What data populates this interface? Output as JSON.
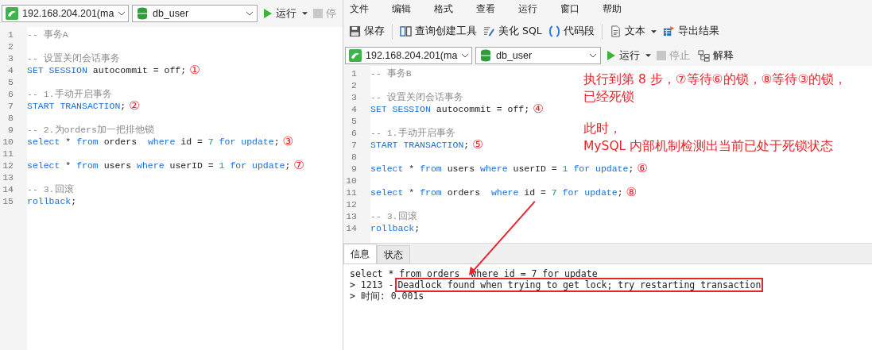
{
  "left_pane": {
    "connection": "192.168.204.201(ma",
    "database": "db_user",
    "run_button": "运行",
    "stop_button": "停",
    "code_lines": [
      {
        "number": "1",
        "tokens": [
          {
            "kind": "comment",
            "text": "-- 事务A"
          }
        ]
      },
      {
        "number": "2"
      },
      {
        "number": "3",
        "tokens": [
          {
            "kind": "comment",
            "text": "-- 设置关闭会话事务"
          }
        ]
      },
      {
        "number": "4",
        "tokens": [
          {
            "kind": "keyword",
            "text": "SET SESSION"
          },
          {
            "kind": "plain",
            "text": " autocommit = off;"
          }
        ],
        "marker": "①"
      },
      {
        "number": "5"
      },
      {
        "number": "6",
        "tokens": [
          {
            "kind": "comment",
            "text": "-- 1.手动开启事务"
          }
        ]
      },
      {
        "number": "7",
        "tokens": [
          {
            "kind": "keyword",
            "text": "START TRANSACTION"
          },
          {
            "kind": "plain",
            "text": ";"
          }
        ],
        "marker": "②"
      },
      {
        "number": "8"
      },
      {
        "number": "9",
        "tokens": [
          {
            "kind": "comment",
            "text": "-- 2.为orders加一把排他锁"
          }
        ]
      },
      {
        "number": "10",
        "tokens": [
          {
            "kind": "keyword",
            "text": "select"
          },
          {
            "kind": "plain",
            "text": " * "
          },
          {
            "kind": "keyword",
            "text": "from"
          },
          {
            "kind": "plain",
            "text": " orders  "
          },
          {
            "kind": "keyword",
            "text": "where"
          },
          {
            "kind": "plain",
            "text": " id = "
          },
          {
            "kind": "number",
            "text": "7"
          },
          {
            "kind": "keyword",
            "text": " for update"
          },
          {
            "kind": "plain",
            "text": ";"
          }
        ],
        "marker": "③"
      },
      {
        "number": "11"
      },
      {
        "number": "12",
        "tokens": [
          {
            "kind": "keyword",
            "text": "select"
          },
          {
            "kind": "plain",
            "text": " * "
          },
          {
            "kind": "keyword",
            "text": "from"
          },
          {
            "kind": "plain",
            "text": " users "
          },
          {
            "kind": "keyword",
            "text": "where"
          },
          {
            "kind": "plain",
            "text": " userID = "
          },
          {
            "kind": "number",
            "text": "1"
          },
          {
            "kind": "keyword",
            "text": " for update"
          },
          {
            "kind": "plain",
            "text": ";"
          }
        ],
        "marker": "⑦"
      },
      {
        "number": "13"
      },
      {
        "number": "14",
        "tokens": [
          {
            "kind": "comment",
            "text": "-- 3.回滚"
          }
        ]
      },
      {
        "number": "15",
        "tokens": [
          {
            "kind": "keyword",
            "text": "rollback"
          },
          {
            "kind": "plain",
            "text": ";"
          }
        ]
      }
    ]
  },
  "right_pane": {
    "menu": [
      "文件",
      "编辑",
      "格式",
      "查看",
      "运行",
      "窗口",
      "帮助"
    ],
    "toolbar": [
      {
        "kind": "save",
        "label": "保存"
      },
      {
        "kind": "builder",
        "label": "查询创建工具"
      },
      {
        "kind": "beautify",
        "label": "美化 SQL"
      },
      {
        "kind": "snippet",
        "label": "代码段"
      },
      {
        "kind": "text",
        "label": "文本"
      },
      {
        "kind": "export",
        "label": "导出结果"
      }
    ],
    "connection": "192.168.204.201(ma",
    "database": "db_user",
    "run_button": "运行",
    "stop_button": "停止",
    "explain_button": "解释",
    "code_lines": [
      {
        "number": "1",
        "tokens": [
          {
            "kind": "comment",
            "text": "-- 事务B"
          }
        ]
      },
      {
        "number": "2"
      },
      {
        "number": "3",
        "tokens": [
          {
            "kind": "comment",
            "text": "-- 设置关闭会话事务"
          }
        ]
      },
      {
        "number": "4",
        "tokens": [
          {
            "kind": "keyword",
            "text": "SET SESSION"
          },
          {
            "kind": "plain",
            "text": " autocommit = off;"
          }
        ],
        "marker": "④"
      },
      {
        "number": "5"
      },
      {
        "number": "6",
        "tokens": [
          {
            "kind": "comment",
            "text": "-- 1.手动开启事务"
          }
        ]
      },
      {
        "number": "7",
        "tokens": [
          {
            "kind": "keyword",
            "text": "START TRANSACTION"
          },
          {
            "kind": "plain",
            "text": ";"
          }
        ],
        "marker": "⑤"
      },
      {
        "number": "8"
      },
      {
        "number": "9",
        "tokens": [
          {
            "kind": "keyword",
            "text": "select"
          },
          {
            "kind": "plain",
            "text": " * "
          },
          {
            "kind": "keyword",
            "text": "from"
          },
          {
            "kind": "plain",
            "text": " users "
          },
          {
            "kind": "keyword",
            "text": "where"
          },
          {
            "kind": "plain",
            "text": " userID = "
          },
          {
            "kind": "number",
            "text": "1"
          },
          {
            "kind": "keyword",
            "text": " for update"
          },
          {
            "kind": "plain",
            "text": ";"
          }
        ],
        "marker": "⑥"
      },
      {
        "number": "10"
      },
      {
        "number": "11",
        "tokens": [
          {
            "kind": "keyword",
            "text": "select"
          },
          {
            "kind": "plain",
            "text": " * "
          },
          {
            "kind": "keyword",
            "text": "from"
          },
          {
            "kind": "plain",
            "text": " orders  "
          },
          {
            "kind": "keyword",
            "text": "where"
          },
          {
            "kind": "plain",
            "text": " id = "
          },
          {
            "kind": "number",
            "text": "7"
          },
          {
            "kind": "keyword",
            "text": " for update"
          },
          {
            "kind": "plain",
            "text": ";"
          }
        ],
        "marker": "⑧"
      },
      {
        "number": "12"
      },
      {
        "number": "13",
        "tokens": [
          {
            "kind": "comment",
            "text": "-- 3.回滚"
          }
        ]
      },
      {
        "number": "14",
        "tokens": [
          {
            "kind": "keyword",
            "text": "rollback"
          },
          {
            "kind": "plain",
            "text": ";"
          }
        ]
      }
    ],
    "annotations": [
      "执行到第 8 步，⑦等待⑥的锁，⑧等待③的锁，已经死锁",
      "此时，",
      "MySQL 内部机制检测出当前已处于死锁状态"
    ],
    "result_tabs": [
      {
        "label": "信息",
        "selected": true
      },
      {
        "label": "状态",
        "selected": false
      }
    ],
    "messages": [
      {
        "kind": "plain",
        "text": "select * from orders  where id = 7 for update"
      },
      {
        "kind": "error",
        "prefix": "> 1213 -",
        "text": "Deadlock found when trying to get lock; try restarting transaction"
      },
      {
        "kind": "plain",
        "text": "> 时间: 0.001s"
      }
    ]
  }
}
